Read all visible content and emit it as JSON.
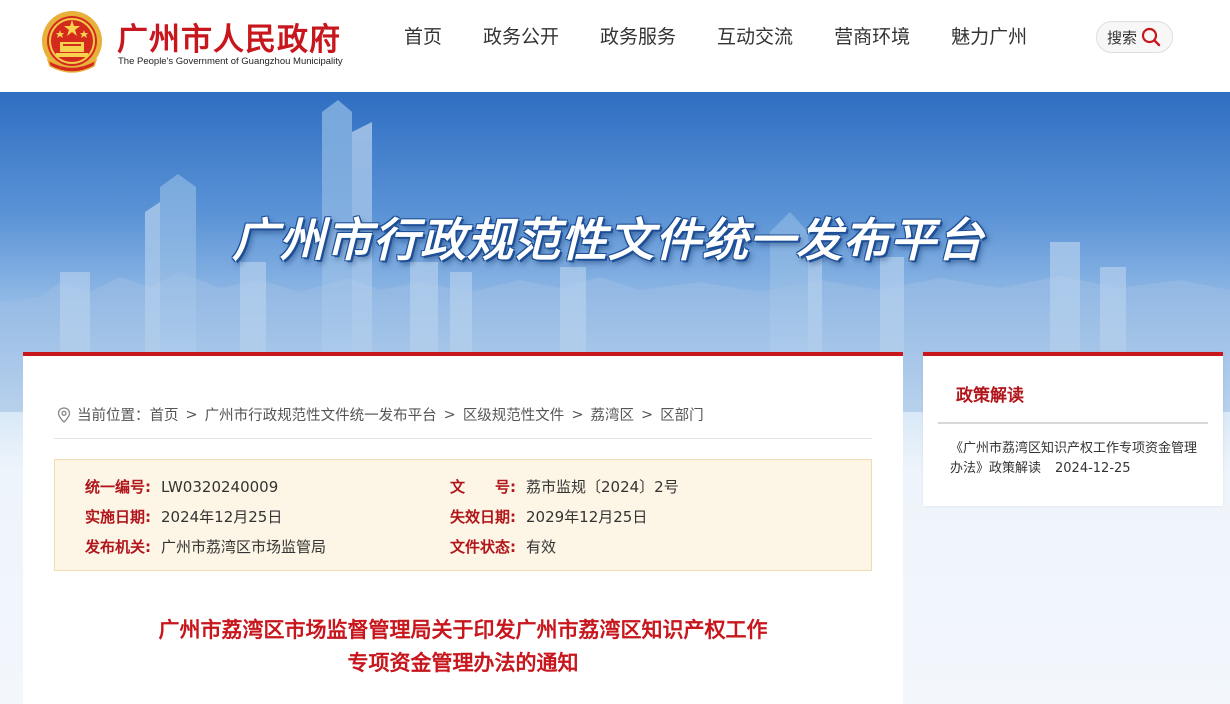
{
  "header": {
    "site_name": "广州市人民政府",
    "site_name_en": "The People's Government of Guangzhou Municipality",
    "nav": [
      "首页",
      "政务公开",
      "政务服务",
      "互动交流",
      "营商环境",
      "魅力广州"
    ],
    "search_label": "搜索"
  },
  "banner": {
    "title": "广州市行政规范性文件统一发布平台"
  },
  "breadcrumb": {
    "prefix": "当前位置：",
    "items": [
      "首页",
      "广州市行政规范性文件统一发布平台",
      "区级规范性文件",
      "荔湾区",
      "区部门"
    ],
    "separator": ">"
  },
  "doc_info": {
    "serial_label": "统一编号:",
    "serial_value": "LW0320240009",
    "doc_no_label": "文　　号:",
    "doc_no_value": "荔市监规〔2024〕2号",
    "effective_label": "实施日期:",
    "effective_value": "2024年12月25日",
    "expiry_label": "失效日期:",
    "expiry_value": "2029年12月25日",
    "issuer_label": "发布机关:",
    "issuer_value": "广州市荔湾区市场监管局",
    "status_label": "文件状态:",
    "status_value": "有效"
  },
  "document": {
    "title_line1": "广州市荔湾区市场监督管理局关于印发广州市荔湾区知识产权工作",
    "title_line2": "专项资金管理办法的通知"
  },
  "side": {
    "title": "政策解读",
    "item_text": "《广州市荔湾区知识产权工作专项资金管理办法》政策解读",
    "item_date": "2024-12-25"
  },
  "colors": {
    "brand_red": "#c8161d",
    "info_bg": "#fdf6e6",
    "banner_blue": "#2f6ec2"
  },
  "icons": [
    "national-emblem-icon",
    "search-icon",
    "location-pin-icon"
  ]
}
